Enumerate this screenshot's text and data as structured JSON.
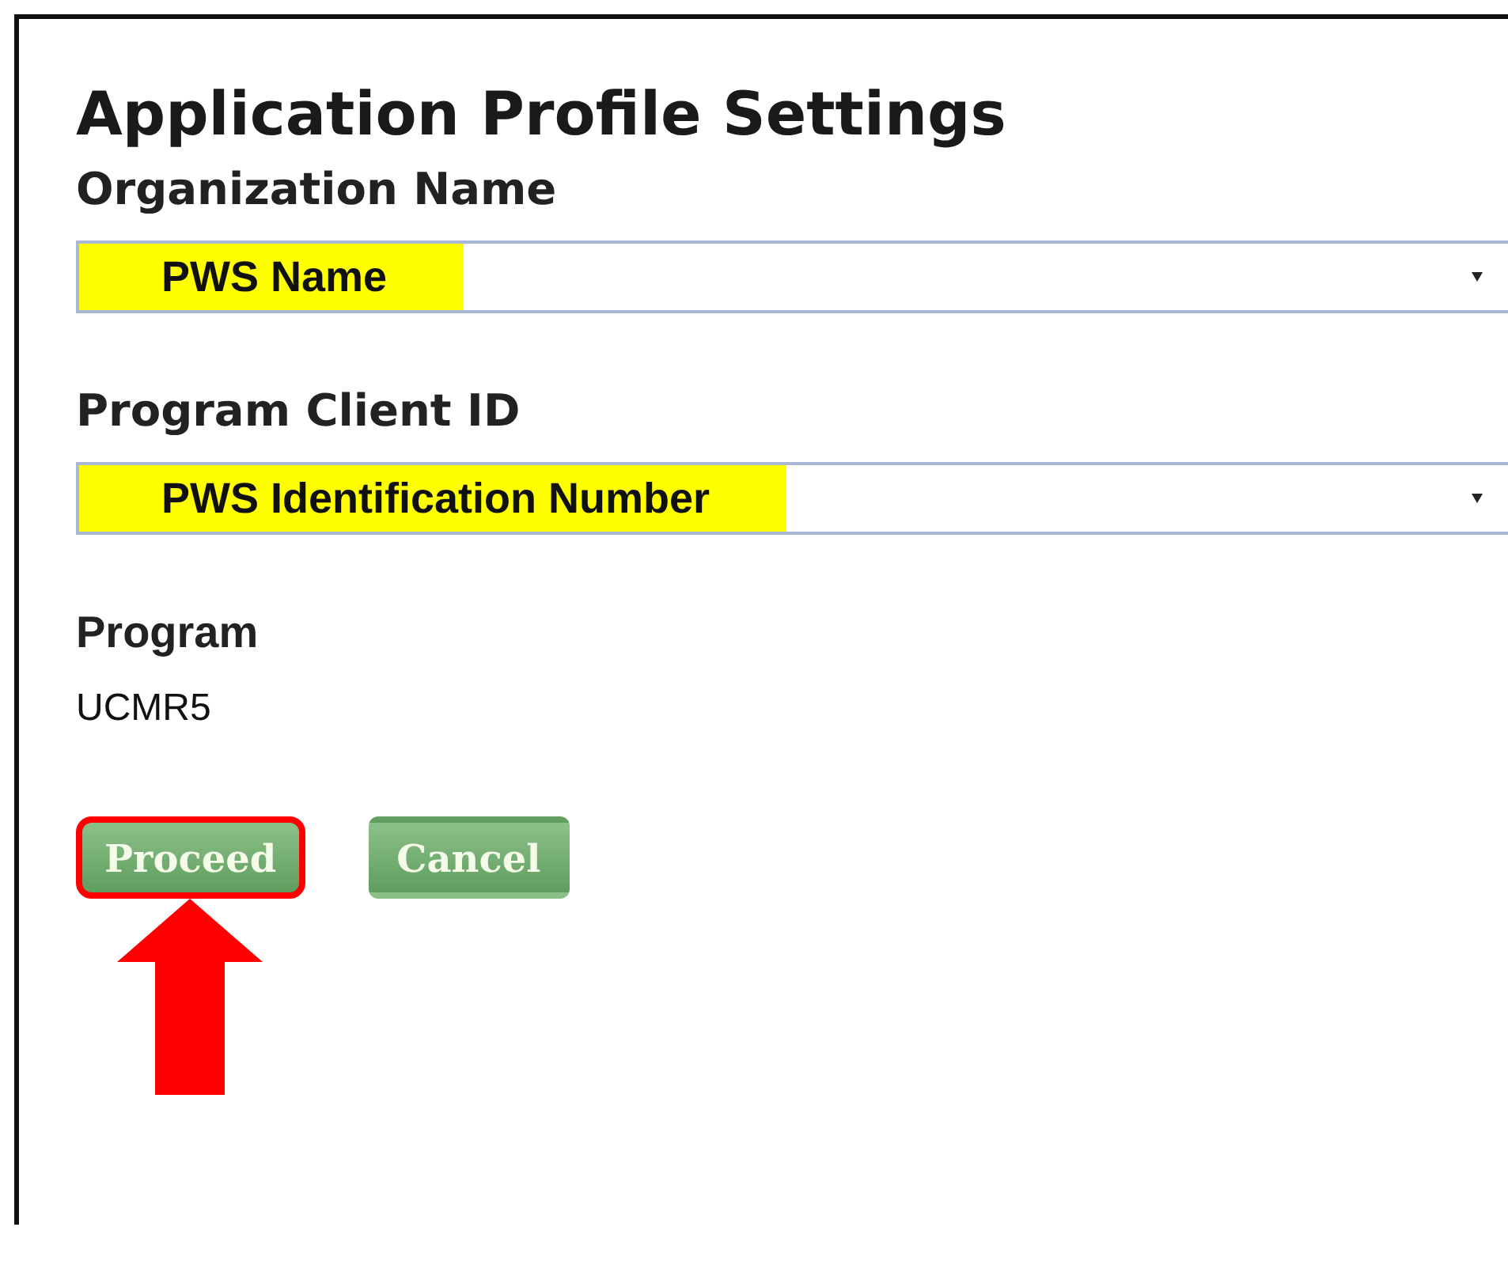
{
  "dialog": {
    "title": "Application Profile Settings"
  },
  "fields": [
    {
      "kind": "dropdown",
      "label": "Organization Name",
      "value": "PWS Name",
      "highlighted": true
    },
    {
      "kind": "dropdown",
      "label": "Program Client ID",
      "value": "PWS Identification Number",
      "highlighted": true
    },
    {
      "kind": "text",
      "label": "Program",
      "value": "UCMR5"
    }
  ],
  "buttons": [
    {
      "label": "Proceed",
      "highlighted": true
    },
    {
      "label": "Cancel",
      "highlighted": false
    }
  ]
}
